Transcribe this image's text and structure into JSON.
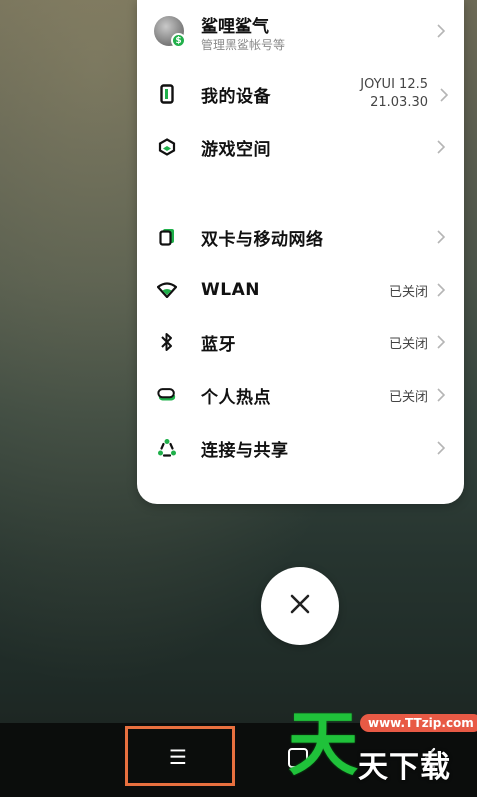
{
  "profile": {
    "name": "鲨哩鲨气",
    "subtitle": "管理黑鲨帐号等",
    "badge": "$"
  },
  "settings": [
    {
      "key": "device",
      "label": "我的设备",
      "icon": "phone-device-icon",
      "value_line1": "JOYUI 12.5",
      "value_line2": "21.03.30"
    },
    {
      "key": "game-space",
      "label": "游戏空间",
      "icon": "hexagon-icon",
      "value": ""
    },
    {
      "key": "sim",
      "label": "双卡与移动网络",
      "icon": "sim-card-icon",
      "value": ""
    },
    {
      "key": "wlan",
      "label": "WLAN",
      "icon": "wifi-icon",
      "value": "已关闭"
    },
    {
      "key": "bluetooth",
      "label": "蓝牙",
      "icon": "bluetooth-icon",
      "value": "已关闭"
    },
    {
      "key": "hotspot",
      "label": "个人热点",
      "icon": "hotspot-icon",
      "value": "已关闭"
    },
    {
      "key": "share",
      "label": "连接与共享",
      "icon": "share-icon",
      "value": ""
    }
  ],
  "close_button": {
    "icon": "close-icon"
  },
  "navbar": {
    "menu_icon": "☰",
    "home_icon": "square-home-icon",
    "back_icon": "chevron-back-icon"
  },
  "watermark": {
    "big": "天",
    "url": "www.TTzip.com",
    "text": "天下载"
  },
  "colors": {
    "accent": "#1fb04a",
    "highlight": "#e8703f",
    "card": "#ffffff"
  }
}
